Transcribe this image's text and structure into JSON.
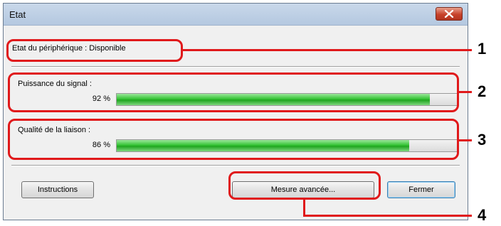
{
  "window": {
    "title": "Etat"
  },
  "device_status": {
    "label": "Etat du périphérique : Disponible"
  },
  "signal": {
    "label": "Puissance du signal :",
    "value_text": "92 %",
    "percent": 92
  },
  "link": {
    "label": "Qualité de la liaison :",
    "value_text": "86 %",
    "percent": 86
  },
  "buttons": {
    "instructions": "Instructions",
    "advanced": "Mesure avancée...",
    "close": "Fermer"
  },
  "callouts": [
    "1",
    "2",
    "3",
    "4"
  ],
  "colors": {
    "callout": "#e0191b",
    "progress": "#1fa51f"
  }
}
